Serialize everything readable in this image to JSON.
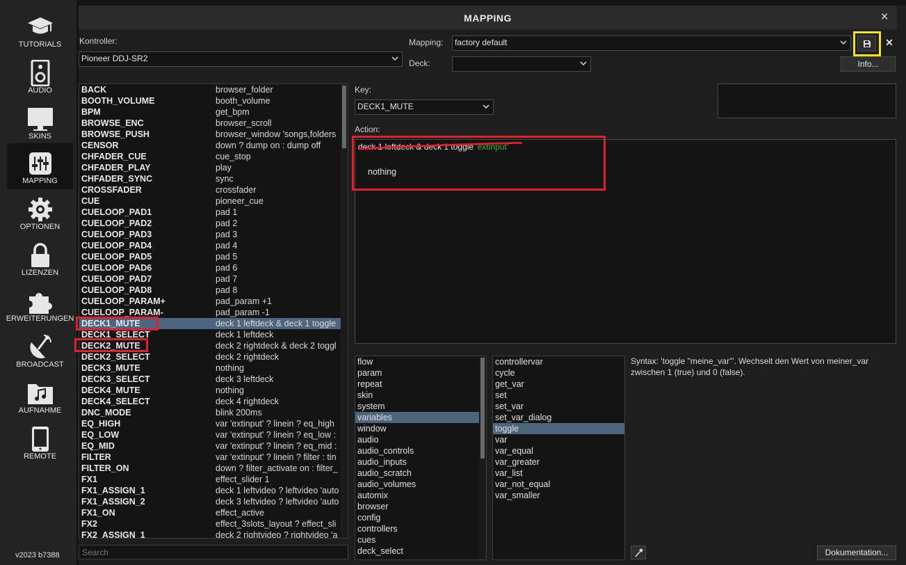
{
  "sidebar": {
    "items": [
      {
        "label": "TUTORIALS",
        "icon": "graduation-cap-icon"
      },
      {
        "label": "AUDIO",
        "icon": "speaker-icon"
      },
      {
        "label": "SKINS",
        "icon": "monitor-icon"
      },
      {
        "label": "MAPPING",
        "icon": "sliders-icon"
      },
      {
        "label": "OPTIONEN",
        "icon": "gear-icon"
      },
      {
        "label": "LIZENZEN",
        "icon": "lock-icon"
      },
      {
        "label": "ERWEITERUNGEN",
        "icon": "puzzle-icon"
      },
      {
        "label": "BROADCAST",
        "icon": "satellite-dish-icon"
      },
      {
        "label": "AUFNAHME",
        "icon": "music-folder-icon"
      },
      {
        "label": "REMOTE",
        "icon": "tablet-icon"
      }
    ],
    "active": "MAPPING",
    "version": "v2023 b7388"
  },
  "dialog": {
    "title": "MAPPING",
    "close": "×",
    "controller_label": "Kontroller:",
    "controller_value": "Pioneer DDJ-SR2",
    "mapping_label": "Mapping:",
    "mapping_value": "factory default",
    "deck_label": "Deck:",
    "deck_value": "",
    "info_button": "Info...",
    "save_icon": "floppy-disk-icon",
    "delete_label": "✕",
    "key_label": "Key:",
    "key_value": "DECK1_MUTE",
    "action_label": "Action:",
    "action_text": "deck 1 leftdeck & deck 1 toggle",
    "action_text_green": "'extinput'",
    "action_nothing": "nothing",
    "search_placeholder": "Search",
    "syntax_text": "Syntax: 'toggle \"meine_var\"'. Wechselt den Wert von meiner_var zwischen 1 (true) und 0 (false).",
    "doc_button": "Dokumentation..."
  },
  "keys": [
    {
      "key": "BACK",
      "action": "browser_folder"
    },
    {
      "key": "BOOTH_VOLUME",
      "action": "booth_volume"
    },
    {
      "key": "BPM",
      "action": "get_bpm"
    },
    {
      "key": "BROWSE_ENC",
      "action": "browser_scroll"
    },
    {
      "key": "BROWSE_PUSH",
      "action": "browser_window 'songs,folders"
    },
    {
      "key": "CENSOR",
      "action": "down ? dump on : dump off"
    },
    {
      "key": "CHFADER_CUE",
      "action": "cue_stop"
    },
    {
      "key": "CHFADER_PLAY",
      "action": "play"
    },
    {
      "key": "CHFADER_SYNC",
      "action": "sync"
    },
    {
      "key": "CROSSFADER",
      "action": "crossfader"
    },
    {
      "key": "CUE",
      "action": "pioneer_cue"
    },
    {
      "key": "CUELOOP_PAD1",
      "action": "pad 1"
    },
    {
      "key": "CUELOOP_PAD2",
      "action": "pad 2"
    },
    {
      "key": "CUELOOP_PAD3",
      "action": "pad 3"
    },
    {
      "key": "CUELOOP_PAD4",
      "action": "pad 4"
    },
    {
      "key": "CUELOOP_PAD5",
      "action": "pad 5"
    },
    {
      "key": "CUELOOP_PAD6",
      "action": "pad 6"
    },
    {
      "key": "CUELOOP_PAD7",
      "action": "pad 7"
    },
    {
      "key": "CUELOOP_PAD8",
      "action": "pad 8"
    },
    {
      "key": "CUELOOP_PARAM+",
      "action": "pad_param +1"
    },
    {
      "key": "CUELOOP_PARAM-",
      "action": "pad_param -1"
    },
    {
      "key": "DECK1_MUTE",
      "action": "deck 1 leftdeck & deck 1 toggle"
    },
    {
      "key": "DECK1_SELECT",
      "action": "deck 1 leftdeck"
    },
    {
      "key": "DECK2_MUTE",
      "action": "deck 2 rightdeck & deck 2 toggl"
    },
    {
      "key": "DECK2_SELECT",
      "action": "deck 2 rightdeck"
    },
    {
      "key": "DECK3_MUTE",
      "action": "nothing"
    },
    {
      "key": "DECK3_SELECT",
      "action": "deck 3 leftdeck"
    },
    {
      "key": "DECK4_MUTE",
      "action": "nothing"
    },
    {
      "key": "DECK4_SELECT",
      "action": "deck 4 rightdeck"
    },
    {
      "key": "DNC_MODE",
      "action": "blink 200ms"
    },
    {
      "key": "EQ_HIGH",
      "action": "var 'extinput' ? linein ? eq_high"
    },
    {
      "key": "EQ_LOW",
      "action": "var 'extinput' ? linein ? eq_low :"
    },
    {
      "key": "EQ_MID",
      "action": "var 'extinput' ? linein ? eq_mid :"
    },
    {
      "key": "FILTER",
      "action": "var 'extinput' ? linein ? filter : tin"
    },
    {
      "key": "FILTER_ON",
      "action": "down ? filter_activate on : filter_"
    },
    {
      "key": "FX1",
      "action": "effect_slider 1"
    },
    {
      "key": "FX1_ASSIGN_1",
      "action": "deck 1 leftvideo ? leftvideo 'auto"
    },
    {
      "key": "FX1_ASSIGN_2",
      "action": "deck 3 leftvideo ? leftvideo 'auto"
    },
    {
      "key": "FX1_ON",
      "action": "effect_active"
    },
    {
      "key": "FX2",
      "action": "effect_3slots_layout ? effect_sli"
    },
    {
      "key": "FX2_ASSIGN_1",
      "action": "deck 2 rightvideo ? rightvideo 'a"
    }
  ],
  "selected_key": "DECK1_MUTE",
  "categories": [
    "flow",
    "param",
    "repeat",
    "skin",
    "system",
    "variables",
    "window",
    "audio",
    "audio_controls",
    "audio_inputs",
    "audio_scratch",
    "audio_volumes",
    "automix",
    "browser",
    "config",
    "controllers",
    "cues",
    "deck_select"
  ],
  "selected_category": "variables",
  "verbs": [
    "controllervar",
    "cycle",
    "get_var",
    "set",
    "set_var",
    "set_var_dialog",
    "toggle",
    "var",
    "var_equal",
    "var_greater",
    "var_list",
    "var_not_equal",
    "var_smaller"
  ],
  "selected_verb": "toggle",
  "colors": {
    "selection": "#4e6580",
    "highlight_red": "#e0202a",
    "highlight_yellow": "#f0e418",
    "green_text": "#3cb43c"
  }
}
